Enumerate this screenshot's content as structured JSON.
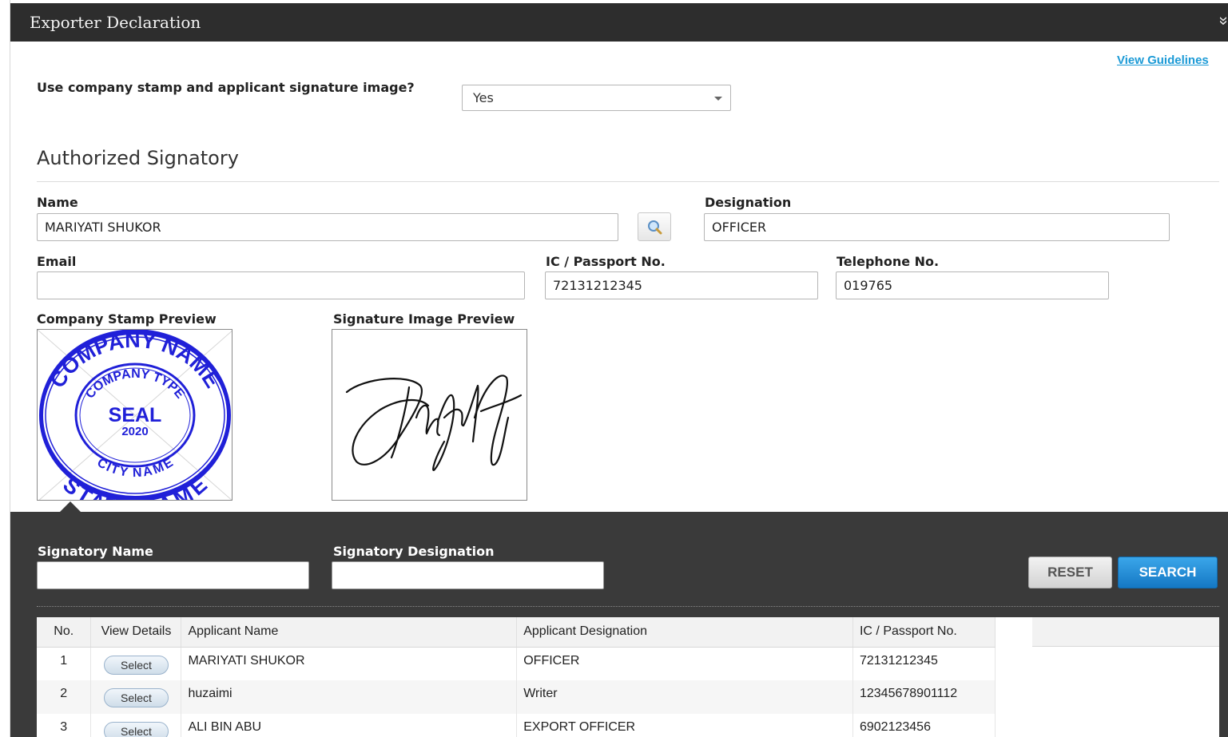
{
  "panel": {
    "title": "Exporter Declaration",
    "collapse_glyph": "»"
  },
  "guidelines_link": "View Guidelines",
  "stamp_question": {
    "label": "Use company stamp and applicant signature image?",
    "value": "Yes"
  },
  "section_title": "Authorized Signatory",
  "form": {
    "name_label": "Name",
    "name_value": "MARIYATI SHUKOR",
    "designation_label": "Designation",
    "designation_value": "OFFICER",
    "email_label": "Email",
    "email_value": "",
    "ic_label": "IC / Passport No.",
    "ic_value": "72131212345",
    "tel_label": "Telephone No.",
    "tel_value": "019765"
  },
  "previews": {
    "stamp_label": "Company Stamp Preview",
    "signature_label": "Signature Image Preview",
    "stamp_text": {
      "outer_top": "COMPANY NAME",
      "inner_top": "COMPANY TYPE",
      "center": "SEAL",
      "year": "2020",
      "inner_bottom": "CITY NAME",
      "outer_bottom": "STATE NAME"
    }
  },
  "search_panel": {
    "signatory_name_label": "Signatory Name",
    "signatory_designation_label": "Signatory Designation",
    "reset_label": "RESET",
    "search_label": "SEARCH"
  },
  "table": {
    "headers": [
      "No.",
      "View Details",
      "Applicant Name",
      "Applicant Designation",
      "IC / Passport No."
    ],
    "select_label": "Select",
    "rows": [
      {
        "no": "1",
        "name": "MARIYATI SHUKOR",
        "designation": "OFFICER",
        "ic": "72131212345"
      },
      {
        "no": "2",
        "name": "huzaimi",
        "designation": "Writer",
        "ic": "12345678901112"
      },
      {
        "no": "3",
        "name": "ALI BIN ABU",
        "designation": "EXPORT OFFICER",
        "ic": "6902123456"
      }
    ]
  },
  "colors": {
    "header_bg": "#2d2d2d",
    "link": "#1b9ad6",
    "stamp_blue": "#2020d8",
    "search_button": "#1e88d6",
    "dark_panel": "#3a3a3a"
  }
}
